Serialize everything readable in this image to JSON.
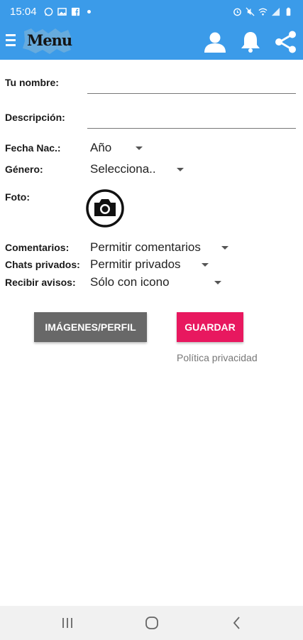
{
  "status_bar": {
    "time": "15:04",
    "icons": [
      "whatsapp-icon",
      "gallery-icon",
      "facebook-icon",
      "dot-icon",
      "alarm-icon",
      "mute-icon",
      "wifi-icon",
      "signal-icon",
      "battery-icon"
    ]
  },
  "app_bar": {
    "logo_text": "Menu",
    "color": "#3b9be9",
    "icons": [
      "menu-icon",
      "profile-icon",
      "bell-icon",
      "share-icon"
    ]
  },
  "form": {
    "name_label": "Tu nombre:",
    "name_value": "",
    "description_label": "Descripción:",
    "description_value": "",
    "birth_label": "Fecha Nac.:",
    "birth_value": "Año",
    "gender_label": "Género:",
    "gender_value": "Selecciona..",
    "photo_label": "Foto:",
    "comments_label": "Comentarios:",
    "comments_value": "Permitir comentarios",
    "chats_label": "Chats privados:",
    "chats_value": "Permitir privados",
    "notices_label": "Recibir avisos:",
    "notices_value": "Sólo con icono"
  },
  "buttons": {
    "images_label": "IMÁGENES/PERFIL",
    "images_color": "#686868",
    "save_label": "GUARDAR",
    "save_color": "#e8185f"
  },
  "privacy_link": "Política privacidad",
  "nav_bar": {
    "icons": [
      "recent-apps-icon",
      "home-icon",
      "back-icon"
    ]
  }
}
